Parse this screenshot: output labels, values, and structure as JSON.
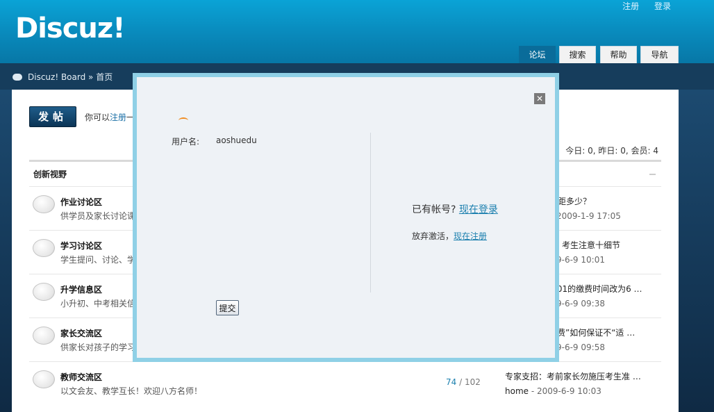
{
  "header": {
    "logo": "Discuz!",
    "links": [
      "注册",
      "登录"
    ],
    "tabs": [
      "论坛",
      "搜索",
      "帮助",
      "导航"
    ]
  },
  "breadcrumb": "Discuz! Board » 首页",
  "toolbar": {
    "post_button": "发帖",
    "notice_prefix": "你可以",
    "notice_link": "注册",
    "notice_suffix": "一",
    "stats": "今日: 0, 昨日: 0, 会员: 4"
  },
  "category": "创新视野",
  "forums": [
    {
      "name": "作业讨论区",
      "desc": "供学员及家长讨论课",
      "posts": "",
      "threads": "",
      "last_title": "相距多少？",
      "last_user": "",
      "last_time": "2009-1-9 17:05"
    },
    {
      "name": "学习讨论区",
      "desc": "学生提问、讨论、学",
      "posts": "",
      "threads": "",
      "last_title": "考生注意十细节",
      "last_user": "",
      "last_time": "9-6-9 10:01"
    },
    {
      "name": "升学信息区",
      "desc": "小升初、中考相关信",
      "posts": "",
      "threads": "",
      "last_title": ".01的缴费时间改为6 …",
      "last_user": "",
      "last_time": "9-6-9 09:38"
    },
    {
      "name": "家长交流区",
      "desc": "供家长对孩子的学习",
      "posts": "",
      "threads": "",
      "last_title": "费”如何保证不“适 …",
      "last_user": "",
      "last_time": "9-6-9 09:58"
    },
    {
      "name": "教师交流区",
      "desc": "以文会友、教学互长！欢迎八方名师！",
      "posts": "74",
      "threads": "102",
      "last_title": "专家支招：考前家长勿施压考生准 …",
      "last_user": "home",
      "last_time": "2009-6-9 10:03"
    }
  ],
  "dialog": {
    "username_label": "用户名:",
    "username_value": "aoshuedu",
    "have_account": "已有帐号?",
    "login_link": "现在登录",
    "give_up": "放弃激活，",
    "register_link": "现在注册",
    "submit_label": "提交",
    "close_glyph": "✕"
  }
}
